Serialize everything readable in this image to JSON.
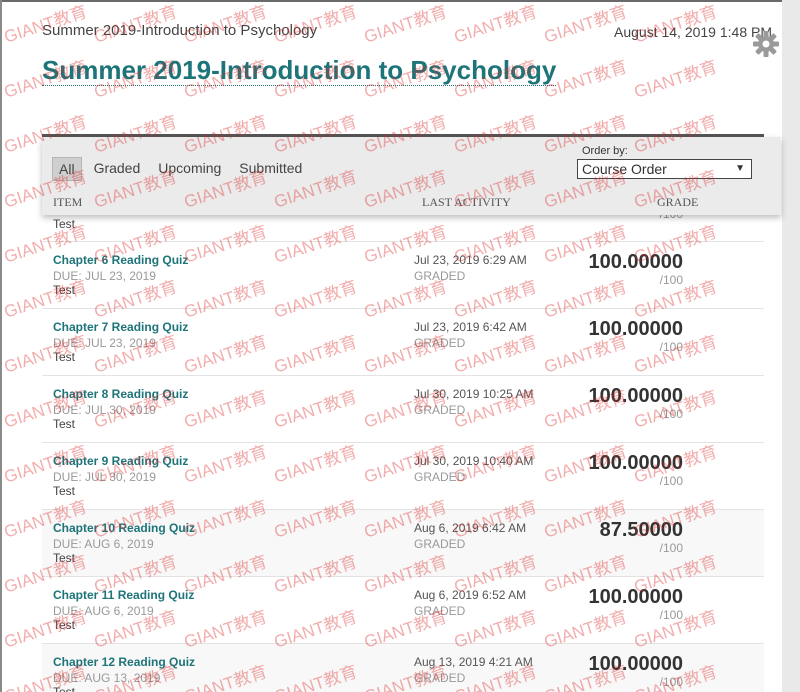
{
  "header": {
    "breadcrumb": "Summer 2019-Introduction to Psychology",
    "datetime": "August 14, 2019 1:48 PM",
    "title": "Summer 2019-Introduction to Psychology"
  },
  "filter": {
    "tabs": [
      {
        "label": "All",
        "active": true
      },
      {
        "label": "Graded",
        "active": false
      },
      {
        "label": "Upcoming",
        "active": false
      },
      {
        "label": "Submitted",
        "active": false
      }
    ],
    "order_label": "Order by:",
    "order_value": "Course Order"
  },
  "columns": {
    "item": "ITEM",
    "activity": "LAST ACTIVITY",
    "grade": "GRADE"
  },
  "partial_row": {
    "type": "Test",
    "max": "/100"
  },
  "rows": [
    {
      "title": "Chapter 6 Reading Quiz",
      "due": "DUE: JUL 23, 2019",
      "type": "Test",
      "activity": "Jul 23, 2019 6:29 AM",
      "status": "GRADED",
      "grade": "100.00000",
      "max": "/100"
    },
    {
      "title": "Chapter 7 Reading Quiz",
      "due": "DUE: JUL 23, 2019",
      "type": "Test",
      "activity": "Jul 23, 2019 6:42 AM",
      "status": "GRADED",
      "grade": "100.00000",
      "max": "/100"
    },
    {
      "title": "Chapter 8 Reading Quiz",
      "due": "DUE: JUL 30, 2019",
      "type": "Test",
      "activity": "Jul 30, 2019 10:25 AM",
      "status": "GRADED",
      "grade": "100.00000",
      "max": "/100"
    },
    {
      "title": "Chapter 9 Reading Quiz",
      "due": "DUE: JUL 30, 2019",
      "type": "Test",
      "activity": "Jul 30, 2019 10:40 AM",
      "status": "GRADED",
      "grade": "100.00000",
      "max": "/100"
    },
    {
      "title": "Chapter 10 Reading Quiz",
      "due": "DUE: AUG 6, 2019",
      "type": "Test",
      "activity": "Aug 6, 2019 6:42 AM",
      "status": "GRADED",
      "grade": "87.50000",
      "max": "/100"
    },
    {
      "title": "Chapter 11 Reading Quiz",
      "due": "DUE: AUG 6, 2019",
      "type": "Test",
      "activity": "Aug 6, 2019 6:52 AM",
      "status": "GRADED",
      "grade": "100.00000",
      "max": "/100"
    },
    {
      "title": "Chapter 12 Reading Quiz",
      "due": "DUE: AUG 13, 2019",
      "type": "Test",
      "activity": "Aug 13, 2019 4:21 AM",
      "status": "GRADED",
      "grade": "100.00000",
      "max": "/100"
    }
  ],
  "watermark": "GIANT教育",
  "colors": {
    "accent": "#1d7479",
    "watermark": "#dc2828"
  },
  "icons": {
    "settings": "gear-icon",
    "dropdown": "triangle-down-icon"
  }
}
